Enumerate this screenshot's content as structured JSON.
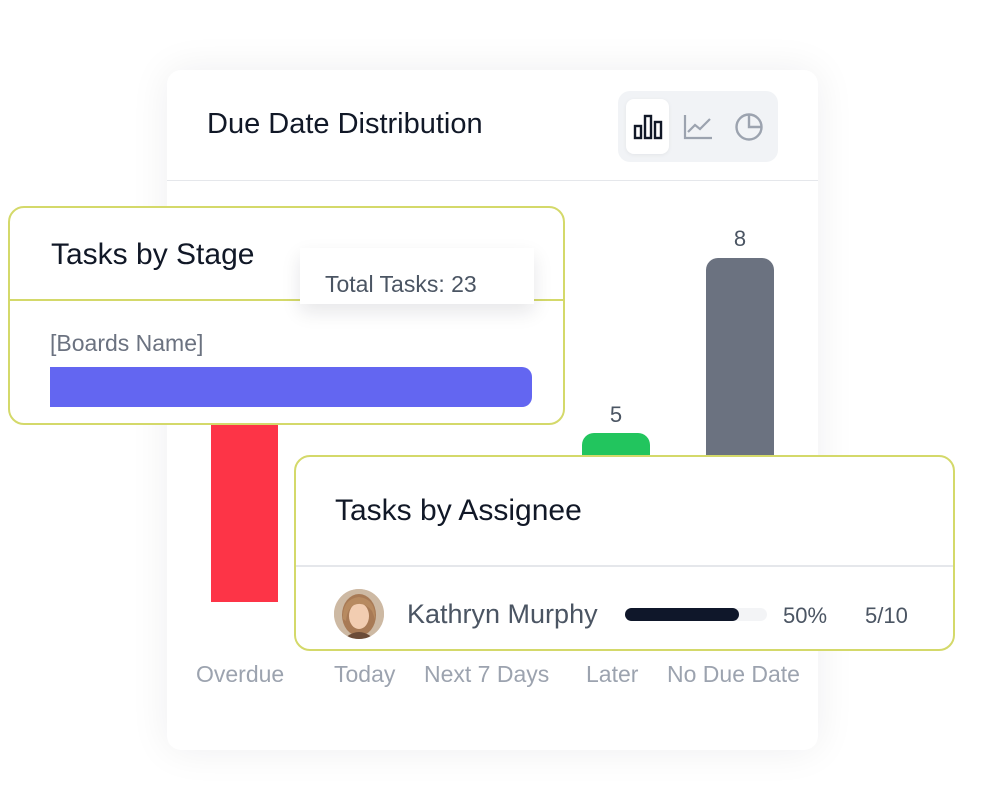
{
  "due_date_widget": {
    "title": "Due Date Distribution",
    "chart_type_buttons": [
      {
        "icon": "bar-chart-icon",
        "active": true
      },
      {
        "icon": "line-chart-icon",
        "active": false
      },
      {
        "icon": "pie-chart-icon",
        "active": false
      }
    ]
  },
  "chart_data": {
    "type": "bar",
    "categories": [
      "Overdue",
      "Today",
      "Next 7 Days",
      "Later",
      "No Due Date"
    ],
    "values": [
      null,
      null,
      null,
      5,
      8
    ],
    "data_labels": [
      "",
      "",
      "",
      "5",
      "8"
    ],
    "colors": [
      "#fd3447",
      "#22c55e",
      "#6b7280"
    ]
  },
  "tasks_by_stage": {
    "title": "Tasks by Stage",
    "board_label": "[Boards Name]",
    "bar_color": "#6366f1",
    "tooltip": "Total Tasks: 23"
  },
  "tasks_by_assignee": {
    "title": "Tasks by Assignee",
    "rows": [
      {
        "name": "Kathryn Murphy",
        "percent_label": "50%",
        "progress": 0.8,
        "count_label": "5/10"
      }
    ]
  },
  "colors": {
    "card_border": "#d4d96a",
    "overdue": "#fd3447",
    "later": "#22c55e",
    "no_due_date": "#6b7280",
    "progress": "#0f172a"
  }
}
